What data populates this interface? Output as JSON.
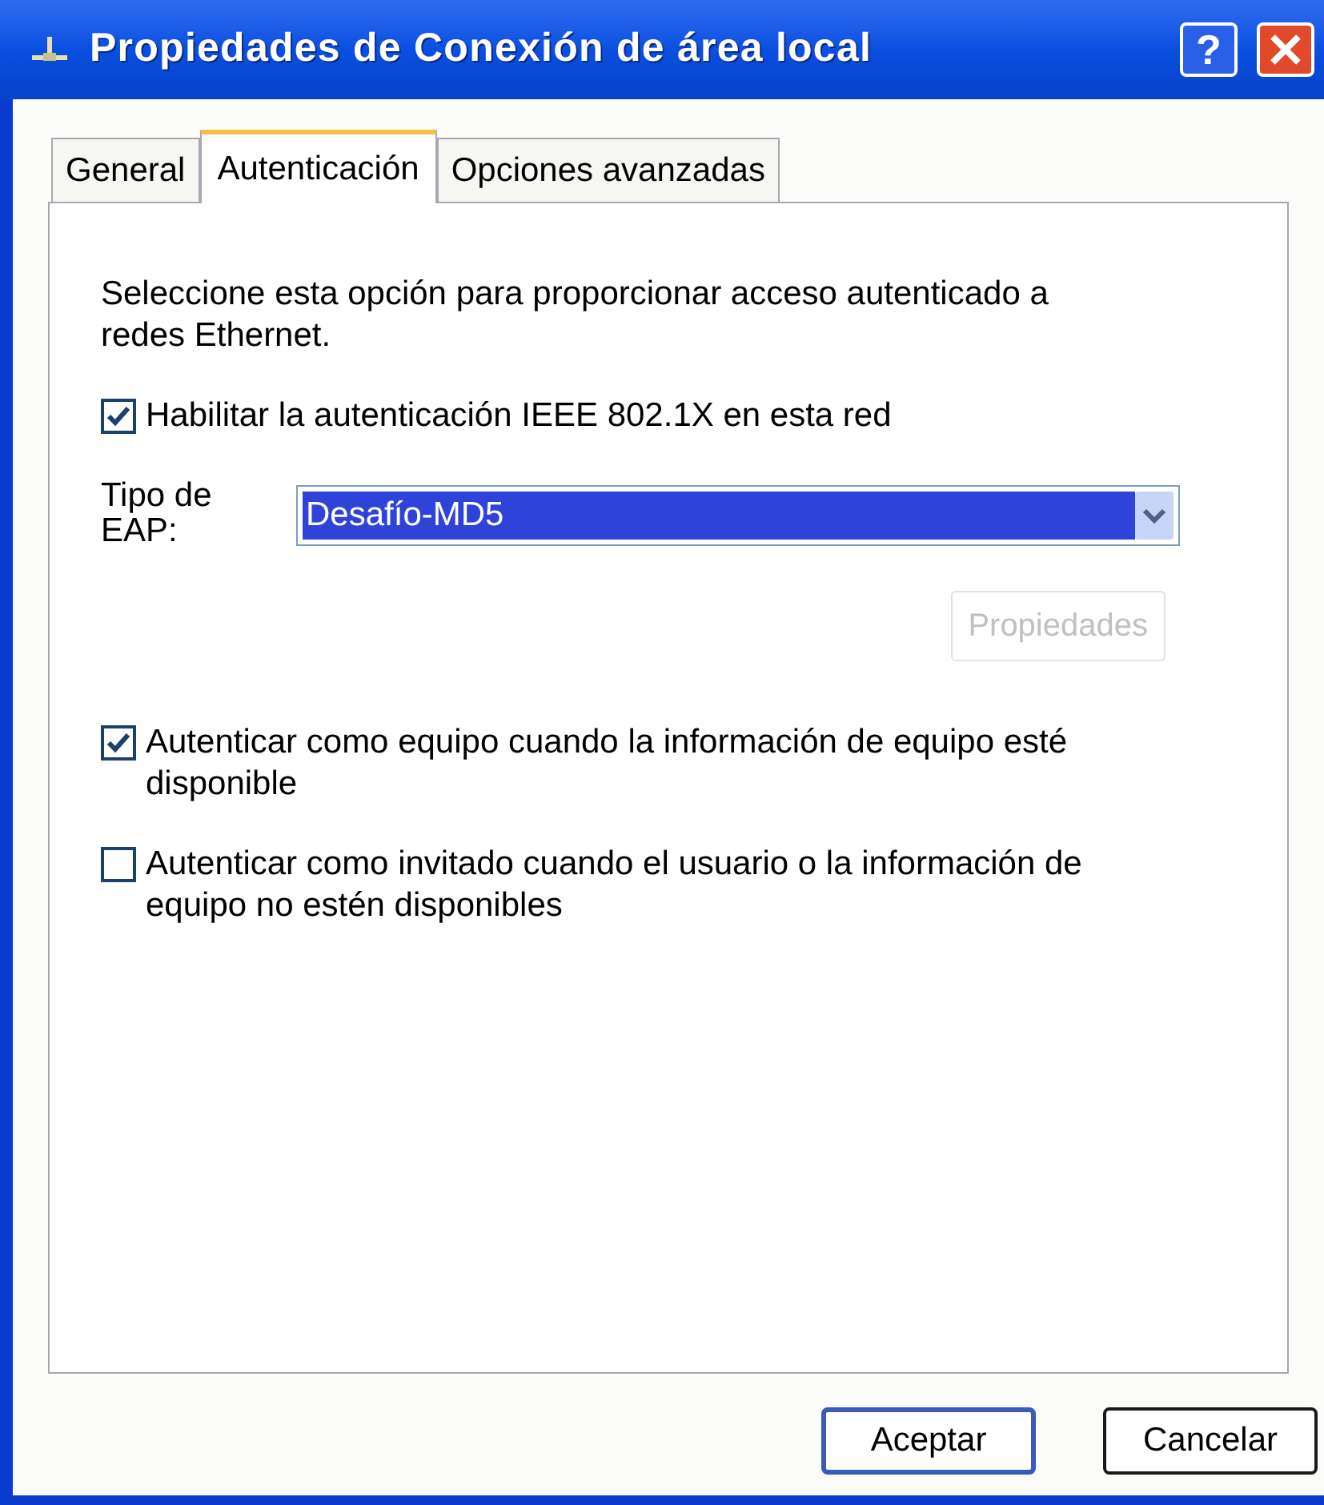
{
  "window": {
    "title": "Propiedades de Conexión de área local",
    "help_button": "?"
  },
  "tabs": [
    {
      "label": "General",
      "selected": false
    },
    {
      "label": "Autenticación",
      "selected": true
    },
    {
      "label": "Opciones avanzadas",
      "selected": false
    }
  ],
  "description": "Seleccione esta opción para proporcionar acceso autenticado a redes Ethernet.",
  "enable_checkbox": {
    "label": "Habilitar la autenticación IEEE 802.1X en esta red",
    "checked": true
  },
  "eap_type": {
    "label": "Tipo de EAP:",
    "value": "Desafío-MD5",
    "selected": true
  },
  "properties_button": {
    "label": "Propiedades",
    "disabled": true
  },
  "options": [
    {
      "label": "Autenticar como equipo cuando la información de equipo esté disponible",
      "checked": true
    },
    {
      "label": "Autenticar como invitado cuando el usuario o la información de equipo no estén disponibles",
      "checked": false
    }
  ],
  "buttons": [
    {
      "label": "Aceptar",
      "default": true
    },
    {
      "label": "Cancelar",
      "default": false
    }
  ]
}
